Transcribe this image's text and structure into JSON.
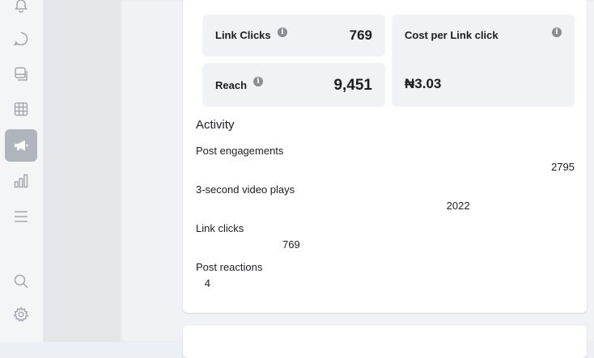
{
  "rail": {
    "icons": [
      {
        "name": "bell-icon"
      },
      {
        "name": "chat-icon"
      },
      {
        "name": "pages-icon"
      },
      {
        "name": "calendar-icon"
      },
      {
        "name": "megaphone-icon",
        "active": true
      },
      {
        "name": "bar-chart-icon"
      },
      {
        "name": "menu-icon"
      },
      {
        "name": "search-icon"
      },
      {
        "name": "settings-icon"
      }
    ]
  },
  "metrics": {
    "link_clicks": {
      "label": "Link Clicks",
      "value": "769"
    },
    "cost_per_link_click": {
      "label": "Cost per Link click",
      "value": "₦3.03"
    },
    "reach": {
      "label": "Reach",
      "value": "9,451"
    }
  },
  "activity": {
    "title": "Activity",
    "rows": [
      {
        "label": "Post engagements",
        "value": 2795
      },
      {
        "label": "3-second video plays",
        "value": 2022
      },
      {
        "label": "Link clicks",
        "value": 769
      },
      {
        "label": "Post reactions",
        "value": 4
      }
    ]
  },
  "colors": {
    "card_bg": "#ffffff",
    "metric_bg": "#f0f2f5",
    "active_nav": "#b0b5bc"
  }
}
